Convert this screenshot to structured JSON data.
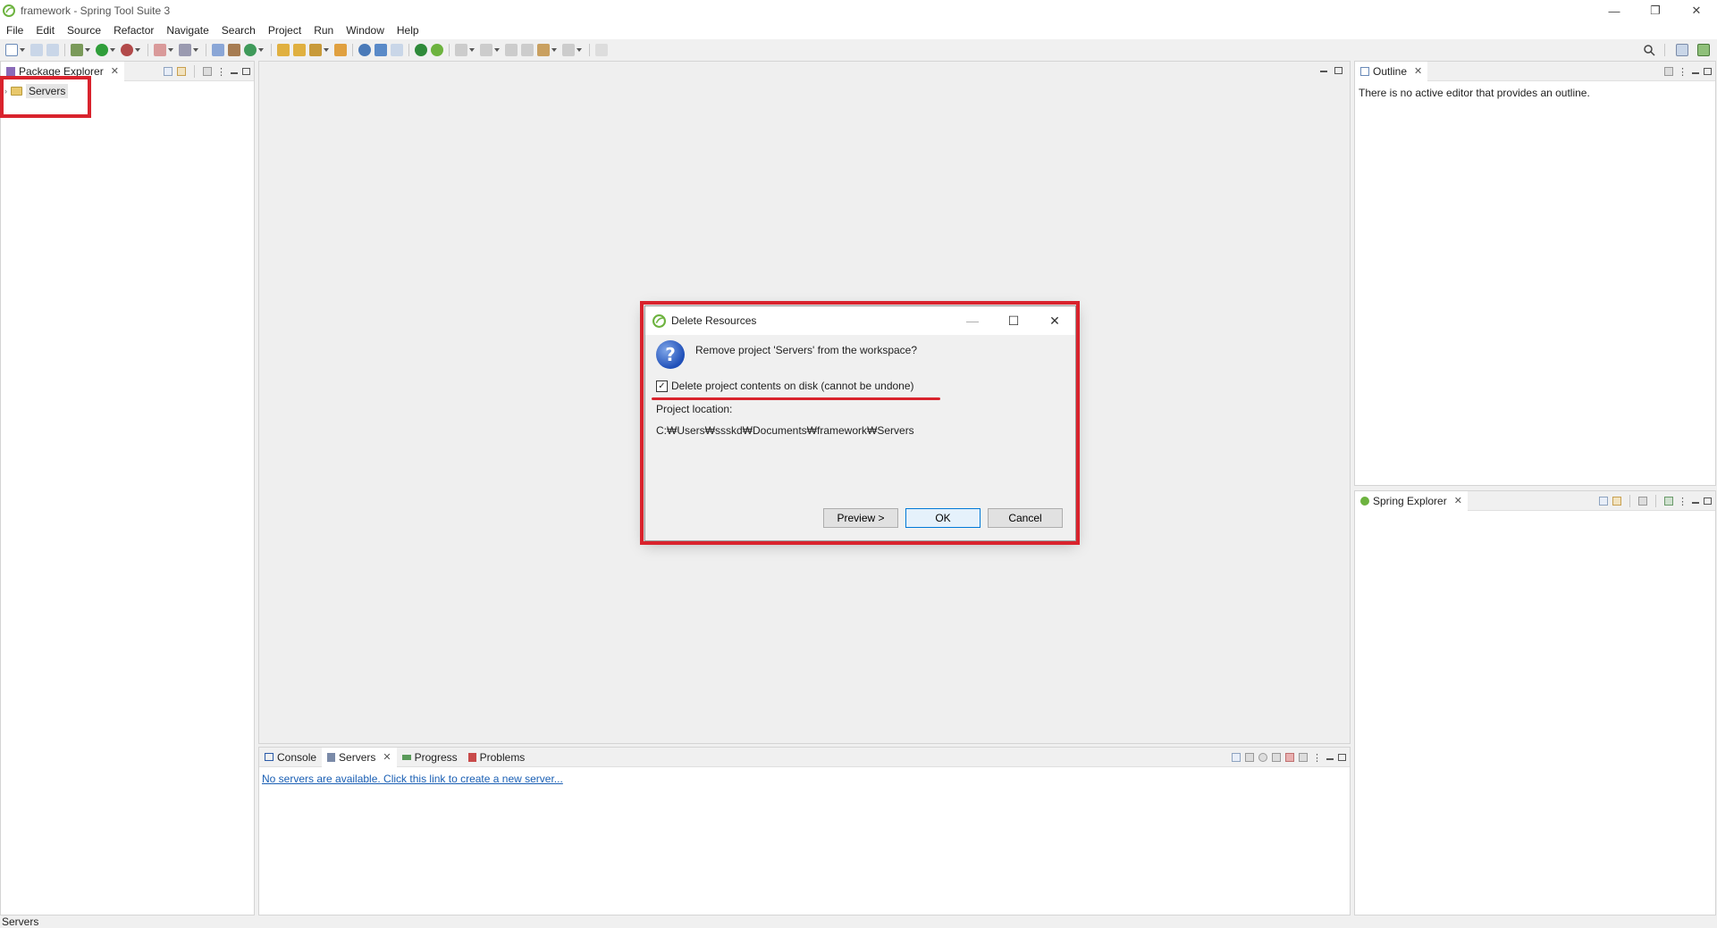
{
  "window": {
    "title": "framework - Spring Tool Suite 3",
    "controls": {
      "minimize": "—",
      "restore": "❐",
      "close": "✕"
    }
  },
  "menu": [
    "File",
    "Edit",
    "Source",
    "Refactor",
    "Navigate",
    "Search",
    "Project",
    "Run",
    "Window",
    "Help"
  ],
  "package_explorer": {
    "tab": "Package Explorer",
    "items": [
      {
        "label": "Servers"
      }
    ]
  },
  "outline": {
    "tab": "Outline",
    "message": "There is no active editor that provides an outline."
  },
  "spring_explorer": {
    "tab": "Spring Explorer"
  },
  "bottom": {
    "tabs": [
      "Console",
      "Servers",
      "Progress",
      "Problems"
    ],
    "active_tab": "Servers",
    "link": "No servers are available. Click this link to create a new server..."
  },
  "status_bar": {
    "text": "Servers"
  },
  "dialog": {
    "title": "Delete Resources",
    "question": "Remove project 'Servers' from the workspace?",
    "checkbox_label": "Delete project contents on disk (cannot be undone)",
    "checkbox_checked": true,
    "location_label": "Project location:",
    "location_path": "C:₩Users₩ssskd₩Documents₩framework₩Servers",
    "buttons": {
      "preview": "Preview >",
      "ok": "OK",
      "cancel": "Cancel"
    },
    "controls": {
      "minimize": "—",
      "maximize": "☐",
      "close": "✕"
    }
  },
  "colors": {
    "annotation_red": "#d9232d",
    "accent": "#0078d7",
    "link": "#1a5fb4"
  }
}
